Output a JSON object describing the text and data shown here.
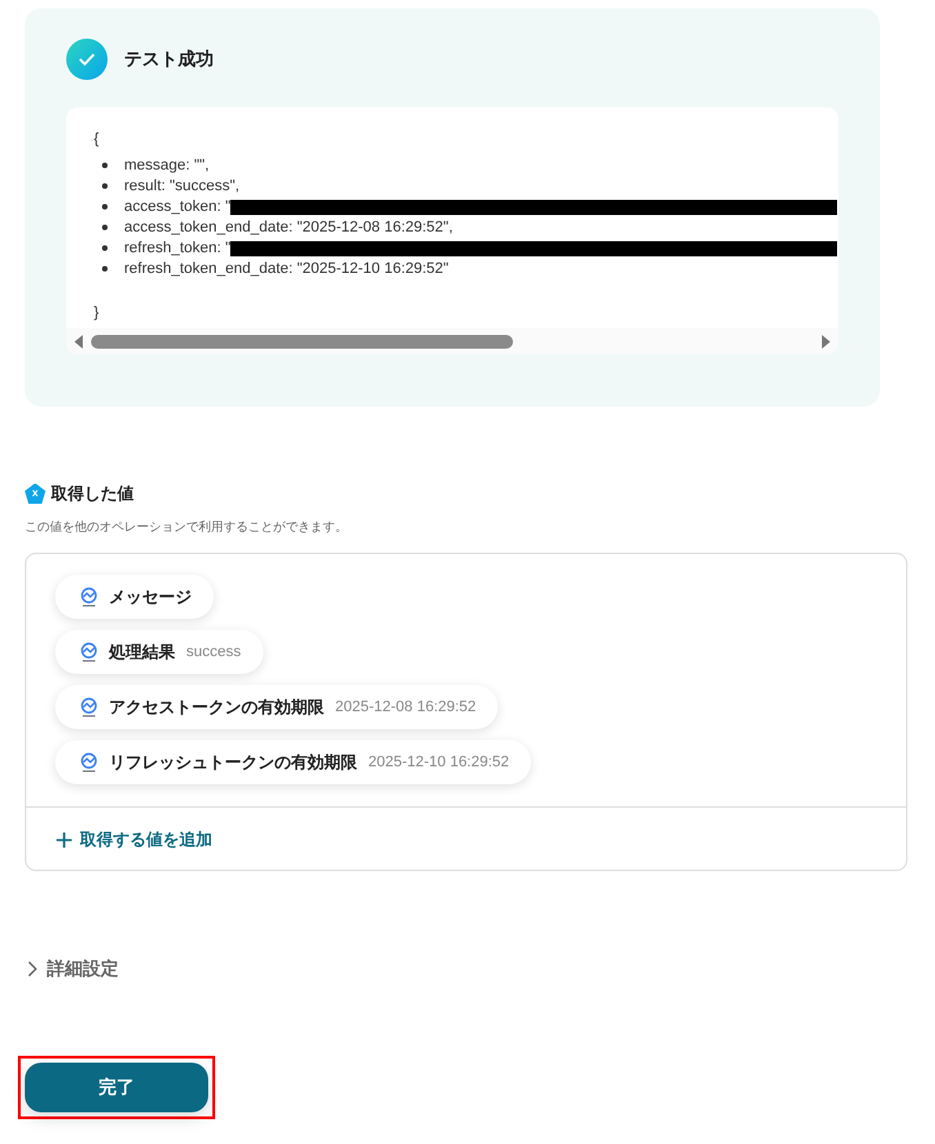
{
  "test_result": {
    "title": "テスト成功",
    "success": true,
    "json_open": "{",
    "json_close": "}",
    "lines": [
      {
        "text": "message: \"\",",
        "redacted": false
      },
      {
        "text": "result: \"success\",",
        "redacted": false
      },
      {
        "text": "access_token: \"",
        "redacted": true
      },
      {
        "text": "access_token_end_date: \"2025-12-08 16:29:52\",",
        "redacted": false
      },
      {
        "text": "refresh_token: \"",
        "redacted": true
      },
      {
        "text": "refresh_token_end_date: \"2025-12-10 16:29:52\"",
        "redacted": false
      }
    ]
  },
  "acquired": {
    "title": "取得した値",
    "badge": "x",
    "description": "この値を他のオペレーションで利用することができます。",
    "values": [
      {
        "label": "メッセージ"
      },
      {
        "label": "処理結果",
        "value": "success"
      },
      {
        "label": "アクセストークンの有効期限",
        "value": "2025-12-08 16:29:52"
      },
      {
        "label": "リフレッシュトークンの有効期限",
        "value": "2025-12-10 16:29:52"
      }
    ],
    "add_label": "取得する値を追加"
  },
  "advanced": {
    "label": "詳細設定",
    "expanded": false
  },
  "submit": {
    "label": "完了",
    "highlighted": true
  }
}
